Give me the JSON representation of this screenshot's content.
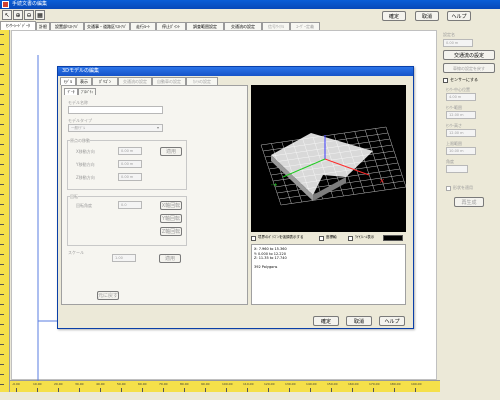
{
  "window": {
    "title": "手続文書の編集"
  },
  "top_buttons": {
    "ok": "確定",
    "cancel": "取消",
    "help": "ヘルプ"
  },
  "toolbar_icons": [
    "pointer-icon",
    "zoom-in-icon",
    "zoom-out-icon",
    "grid-icon"
  ],
  "main_tabs": [
    {
      "label": "ｾﾝｻｰｼｰﾄﾞﾃﾞｰﾀ",
      "state": "active"
    },
    {
      "label": "計根",
      "state": "normal"
    },
    {
      "label": "設置部ﾘｽﾄｱﾊﾞ",
      "state": "normal"
    },
    {
      "label": "交通事・道路区ﾘｽﾄｱﾊﾞ",
      "state": "normal"
    },
    {
      "label": "走行ﾙｰﾄ",
      "state": "normal"
    },
    {
      "label": "停止ﾎﾟｲﾝﾄ",
      "state": "normal"
    },
    {
      "label": "調査範囲設定",
      "state": "normal"
    },
    {
      "label": "交通流の設定",
      "state": "normal"
    },
    {
      "label": "信号ｻｲｸﾙ",
      "state": "disabled"
    },
    {
      "label": "ﾕｰｻﾞｰ定義",
      "state": "disabled"
    }
  ],
  "right_panel": {
    "title_label": "設定名",
    "value1": "0.00 m",
    "traffic_button": "交通流の設定",
    "reset_button": "車線の設定を戻す",
    "sensor_checkbox": "センサーにする",
    "fields": [
      {
        "label": "ｾﾝｻｰ中心位置",
        "value": "4.00 m"
      },
      {
        "label": "ｾﾝｻｰ範囲",
        "value": "12.00 m"
      },
      {
        "label": "ｾﾝｻｰ高さ",
        "value": "12.00 m"
      },
      {
        "label": "上限範囲",
        "value": "10.00 m"
      },
      {
        "label": "角度",
        "value": ""
      }
    ],
    "opt_checkbox": "形状を適用",
    "apply_button": "再生成"
  },
  "dialog": {
    "title": "3Dモデルの編集",
    "tabs": [
      {
        "label": "ﾓﾃﾞﾙ",
        "state": "active"
      },
      {
        "label": "表示",
        "state": "normal"
      },
      {
        "label": "ﾎﾟﾘｺﾞﾝ",
        "state": "normal"
      },
      {
        "label": "交通流の設定",
        "state": "disabled"
      },
      {
        "label": "自動車の設定",
        "state": "disabled"
      },
      {
        "label": "ｶﾒﾗの設定",
        "state": "disabled"
      }
    ],
    "subtabs": [
      "ﾃﾞｰﾀ",
      "ﾌﾟﾛﾊﾟﾃｨ"
    ],
    "model_name_label": "モデル名称",
    "model_name_value": "",
    "model_type_label": "モデルタイプ",
    "model_type_value": "一般ﾓﾃﾞﾙ",
    "move_group": {
      "title": "原点の移動",
      "rows": [
        {
          "label": "X移動方向",
          "value": "0.00 m",
          "button": "適用"
        },
        {
          "label": "Y移動方向",
          "value": "0.00 m",
          "button": ""
        },
        {
          "label": "Z移動方向",
          "value": "0.00 m",
          "button": ""
        }
      ]
    },
    "rotate_group": {
      "title": "回転",
      "rows": [
        {
          "label": "回転角度",
          "value": "0.0",
          "button": "X軸回転"
        },
        {
          "label": "",
          "value": "",
          "button": "Y軸回転"
        },
        {
          "label": "",
          "value": "",
          "button": "Z軸回転"
        }
      ]
    },
    "scale_group": {
      "title": "スケール",
      "value": "1.00",
      "button": "適用"
    },
    "reset_button": "元に戻す",
    "view_options": {
      "boundary": "境界のﾎﾟﾘｺﾞﾝを強調表示する",
      "axis": "座標軸",
      "wire": "ﾜｲﾔﾌﾚｰﾑ表示"
    },
    "info_lines": [
      "X: 7.960 to 15.360",
      "Y: 0.000 to 12.220",
      "Z: 11.35 to 17.740",
      "",
      "392 Polygons"
    ],
    "buttons": {
      "ok": "確定",
      "cancel": "取消",
      "help": "ヘルプ"
    }
  },
  "ruler": {
    "h_labels": [
      "-0.00",
      "10.00",
      "20.00",
      "30.00",
      "40.00",
      "50.00",
      "60.00",
      "70.00",
      "80.00",
      "90.00",
      "100.00",
      "110.00",
      "120.00",
      "130.00",
      "140.00",
      "150.00",
      "160.00",
      "170.00",
      "180.00",
      "190.00"
    ]
  },
  "colors": {
    "ruler": "#f5e04a",
    "titlebar": "#0a5ed7",
    "viewport_bg": "#000000"
  }
}
